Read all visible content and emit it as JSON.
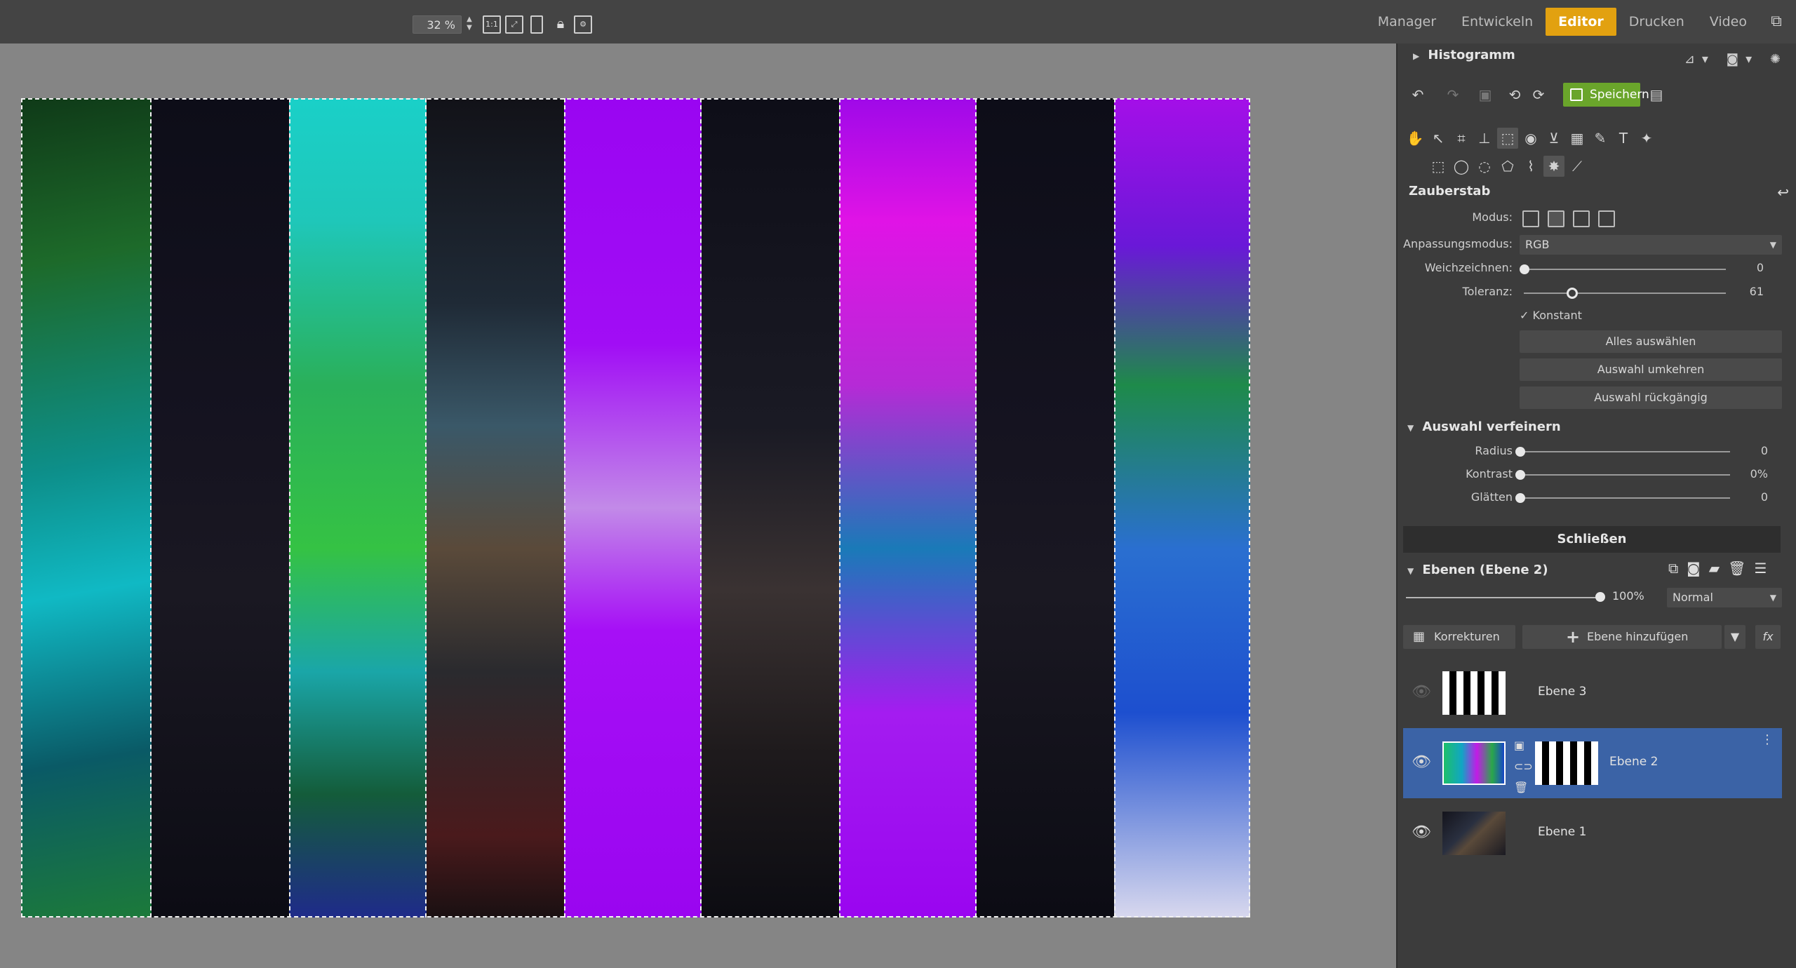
{
  "topbar": {
    "zoom_value": "32 %",
    "zoom_1to1_label": "1:1",
    "mode_tabs": [
      {
        "label": "Manager"
      },
      {
        "label": "Entwickeln"
      },
      {
        "label": "Editor"
      },
      {
        "label": "Drucken"
      },
      {
        "label": "Video"
      }
    ],
    "active_tab_index": 2,
    "accent_color": "#e2a110"
  },
  "histogram": {
    "title": "Histogramm"
  },
  "actions": {
    "save_label": "Speichern",
    "save_color": "#6aa52b"
  },
  "tool": {
    "title": "Zauberstab",
    "modus_label": "Modus:",
    "anpassung_label": "Anpassungsmodus:",
    "anpassung_value": "RGB",
    "weich_label": "Weichzeichnen:",
    "weich_value": "0",
    "weich_fraction": 0,
    "toleranz_label": "Toleranz:",
    "toleranz_value": "61",
    "toleranz_fraction": 0.24,
    "konstant_label": "Konstant",
    "konstant_checked": true,
    "btn_select_all": "Alles auswählen",
    "btn_invert": "Auswahl umkehren",
    "btn_undo": "Auswahl rückgängig"
  },
  "refine": {
    "title": "Auswahl verfeinern",
    "radius_label": "Radius",
    "radius_value": "0",
    "kontrast_label": "Kontrast",
    "kontrast_value": "0%",
    "glaetten_label": "Glätten",
    "glaetten_value": "0"
  },
  "close_label": "Schließen",
  "layers": {
    "title": "Ebenen (Ebene 2)",
    "opacity_value": "100%",
    "opacity_fraction": 1.0,
    "blend_mode": "Normal",
    "korrekturen_label": "Korrekturen",
    "add_layer_label": "Ebene hinzufügen",
    "fx_label": "fx",
    "items": [
      {
        "name": "Ebene 3",
        "visible": false,
        "selected": false
      },
      {
        "name": "Ebene 2",
        "visible": true,
        "selected": true
      },
      {
        "name": "Ebene 1",
        "visible": true,
        "selected": false
      }
    ],
    "selected_color": "#3b63a6"
  }
}
